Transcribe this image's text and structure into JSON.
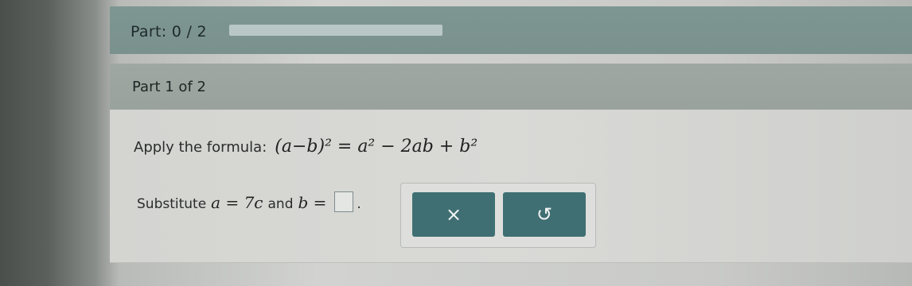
{
  "progress": {
    "label": "Part: 0 / 2",
    "completed_fraction": 0
  },
  "part": {
    "label": "Part 1 of 2"
  },
  "question": {
    "formula_intro": "Apply the formula:",
    "formula": "(a−b)² = a² − 2ab + b²",
    "substitute_prefix": "Substitute",
    "substitute_a": "a = 7c",
    "substitute_and": "and",
    "substitute_b": "b =",
    "answer_value": "",
    "period": "."
  },
  "toolbox": {
    "clear_symbol": "×",
    "undo_symbol": "↺",
    "clear_icon": "close-icon",
    "undo_icon": "undo-icon"
  }
}
